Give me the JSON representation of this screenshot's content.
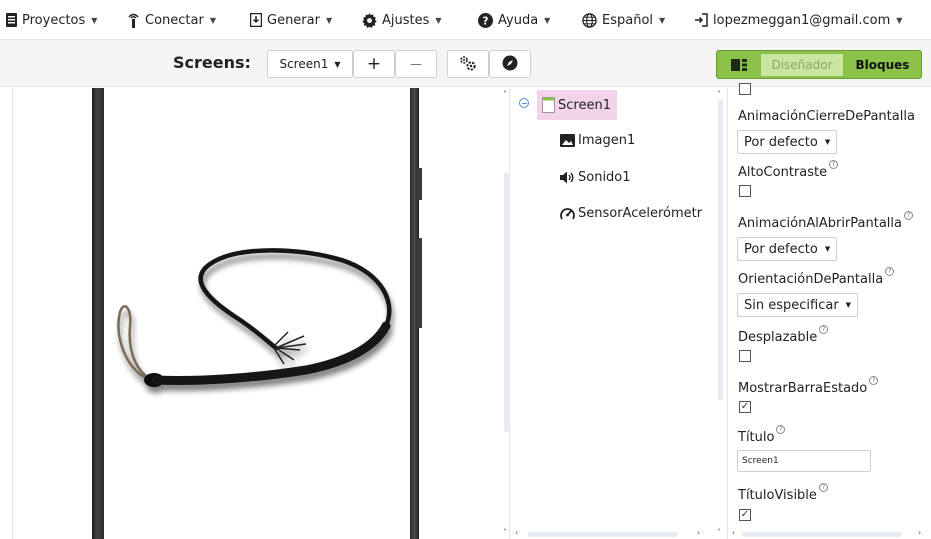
{
  "menu": {
    "projects": "Proyectos",
    "connect": "Conectar",
    "build": "Generar",
    "settings": "Ajustes",
    "help": "Ayuda",
    "language": "Español",
    "account": "lopezmeggan1@gmail.com"
  },
  "toolbar": {
    "screens_label": "Screens:",
    "screen_select": "Screen1",
    "add_screen": "+",
    "remove_screen": "—",
    "designer": "Diseñador",
    "blocks": "Bloques"
  },
  "components": {
    "root": "Screen1",
    "items": [
      "Imagen1",
      "Sonido1",
      "SensorAcelerómetr"
    ]
  },
  "properties": {
    "anim_close": {
      "label": "AnimaciónCierreDePantalla",
      "value": "Por defecto"
    },
    "high_contrast": {
      "label": "AltoContraste",
      "checked": false
    },
    "anim_open": {
      "label": "AnimaciónAlAbrirPantalla",
      "value": "Por defecto"
    },
    "orientation": {
      "label": "OrientaciónDePantalla",
      "value": "Sin especificar"
    },
    "scrollable": {
      "label": "Desplazable",
      "checked": false
    },
    "show_status": {
      "label": "MostrarBarraEstado",
      "checked": true
    },
    "title": {
      "label": "Título",
      "value": "Screen1"
    },
    "title_visible": {
      "label": "TítuloVisible",
      "checked": true
    }
  },
  "help_glyph": "?",
  "check_glyph": "✓",
  "colors": {
    "accent_green": "#8bc34a",
    "designer_disabled": "#c8e6a0",
    "selected_item": "#f3d3ea"
  }
}
